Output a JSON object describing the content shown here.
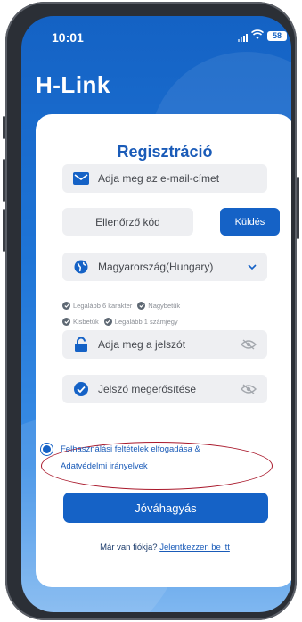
{
  "status_bar": {
    "time": "10:01",
    "battery": "58"
  },
  "app": {
    "title": "H-Link"
  },
  "form": {
    "title": "Regisztráció",
    "email_placeholder": "Adja meg az e-mail-címet",
    "code_placeholder": "Ellenőrző kód",
    "send_label": "Küldés",
    "country_value": "Magyarország(Hungary)",
    "requirements": [
      "Legalább 6 karakter",
      "Nagybetűk",
      "Kisbetűk",
      "Legalább 1 számjegy"
    ],
    "password_placeholder": "Adja meg a jelszót",
    "confirm_placeholder": "Jelszó megerősítése",
    "terms_line1": "Felhasználási feltételek elfogadása &",
    "terms_line2": "Adatvédelmi irányelvek",
    "approve_label": "Jóváhagyás",
    "login_prompt": "Már van fiókja?",
    "login_link": "Jelentkezzen be itt"
  },
  "colors": {
    "accent": "#1562c6",
    "highlight_oval": "#a9182b"
  },
  "icons": [
    "mail-icon",
    "globe-icon",
    "chevron-down-icon",
    "lock-icon",
    "check-circle-icon",
    "eye-off-icon",
    "wifi-icon",
    "signal-icon",
    "battery-icon"
  ]
}
